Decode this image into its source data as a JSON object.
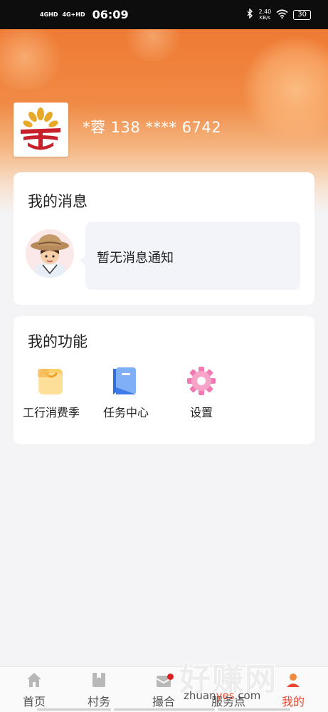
{
  "status_bar": {
    "signal_1": "4GHD",
    "signal_2": "4G+HD",
    "time": "06:09",
    "speed_value": "2.40",
    "speed_unit": "KB/s",
    "battery": "30"
  },
  "profile": {
    "username": "*蓉 138 **** 6742",
    "logo_icon": "bank-logo-icon"
  },
  "messages": {
    "title": "我的消息",
    "empty_text": "暂无消息通知",
    "avatar_icon": "farmer-avatar-icon"
  },
  "functions": {
    "title": "我的功能",
    "items": [
      {
        "label": "工行消费季",
        "icon": "shopping-bag-icon"
      },
      {
        "label": "任务中心",
        "icon": "task-bookmark-icon"
      },
      {
        "label": "设置",
        "icon": "gear-icon"
      }
    ]
  },
  "tabbar": {
    "items": [
      {
        "label": "首页",
        "icon": "home-icon"
      },
      {
        "label": "村务",
        "icon": "village-affairs-icon"
      },
      {
        "label": "撮合",
        "icon": "matchmaking-icon",
        "badge": true
      },
      {
        "label": "服务点",
        "icon": "service-point-icon"
      },
      {
        "label": "我的",
        "icon": "profile-icon",
        "active": true
      }
    ]
  },
  "watermark": {
    "big": "好赚网",
    "small_prefix": "zhuan",
    "small_highlight": "yes",
    "small_suffix": ".com"
  },
  "colors": {
    "brand_orange": "#ee7a33",
    "active_red": "#e9482f",
    "badge_red": "#e02020"
  }
}
